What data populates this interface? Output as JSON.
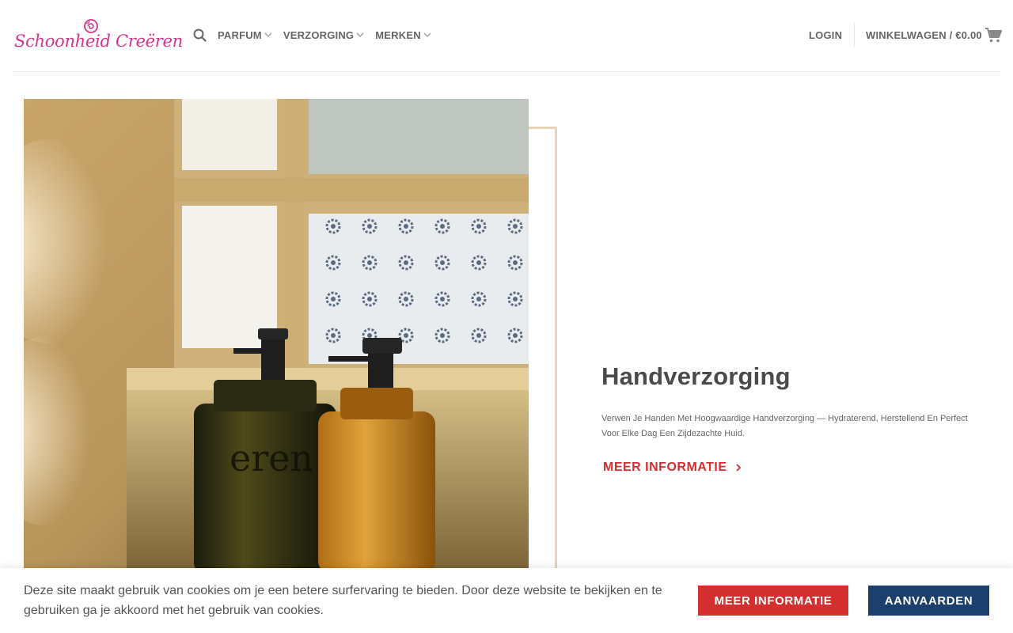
{
  "header": {
    "logo_text": "Schoonheid Creëren",
    "nav": [
      {
        "label": "PARFUM"
      },
      {
        "label": "VERZORGING"
      },
      {
        "label": "MERKEN"
      }
    ],
    "login_label": "LOGIN",
    "cart_label": "WINKELWAGEN / €0.00"
  },
  "hero": {
    "title": "Handverzorging",
    "description": "Verwen Je Handen Met Hoogwaardige Handverzorging — Hydraterend, Herstellend En Perfect Voor Elke Dag Een Zijdezachte Huid.",
    "link_label": "MEER INFORMATIE",
    "image_alt": "Twee zeepdispensers bij een raam"
  },
  "cookie": {
    "text": "Deze site maakt gebruik van cookies om je een betere surfervaring te bieden. Door deze website te bekijken en te gebruiken ga je akkoord met het gebruik van cookies.",
    "info_label": "MEER INFORMATIE",
    "accept_label": "AANVAARDEN"
  },
  "colors": {
    "brand": "#d6338f",
    "accent_red": "#d32f2f",
    "accept_blue": "#1d3f6e",
    "frame_gold": "#e6d6b8"
  },
  "icons": {
    "search": "search-icon",
    "chevron": "chevron-down-icon",
    "cart": "cart-icon",
    "arrow": "chevron-right-icon",
    "logo": "rose-icon"
  }
}
